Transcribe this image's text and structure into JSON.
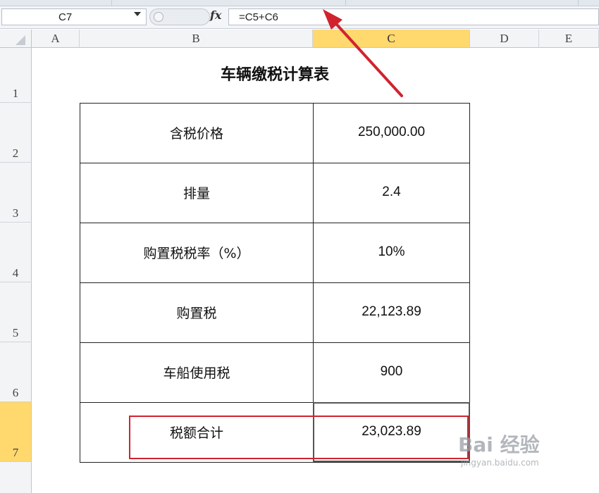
{
  "formula_bar": {
    "name_box": "C7",
    "fx_label": "fx",
    "formula": "=C5+C6"
  },
  "columns": [
    "A",
    "B",
    "C",
    "D",
    "E"
  ],
  "rows": [
    "1",
    "2",
    "3",
    "4",
    "5",
    "6",
    "7"
  ],
  "active_cell": {
    "column": "C",
    "row": "7"
  },
  "sheet": {
    "title": "车辆缴税计算表",
    "table": [
      {
        "label": "含税价格",
        "value": "250,000.00"
      },
      {
        "label": "排量",
        "value": "2.4"
      },
      {
        "label": "购置税税率（%）",
        "value": "10%"
      },
      {
        "label": "购置税",
        "value": "22,123.89"
      },
      {
        "label": "车船使用税",
        "value": "900"
      },
      {
        "label": "税额合计",
        "value": "23,023.89"
      }
    ]
  },
  "annotations": {
    "highlight_color": "#d0232f",
    "arrow_color": "#d0232f"
  },
  "watermark": {
    "main": "Bai 经验",
    "sub": "jingyan.baidu.com"
  },
  "colors": {
    "active_header": "#ffd86e",
    "header_bg": "#f3f4f6"
  }
}
